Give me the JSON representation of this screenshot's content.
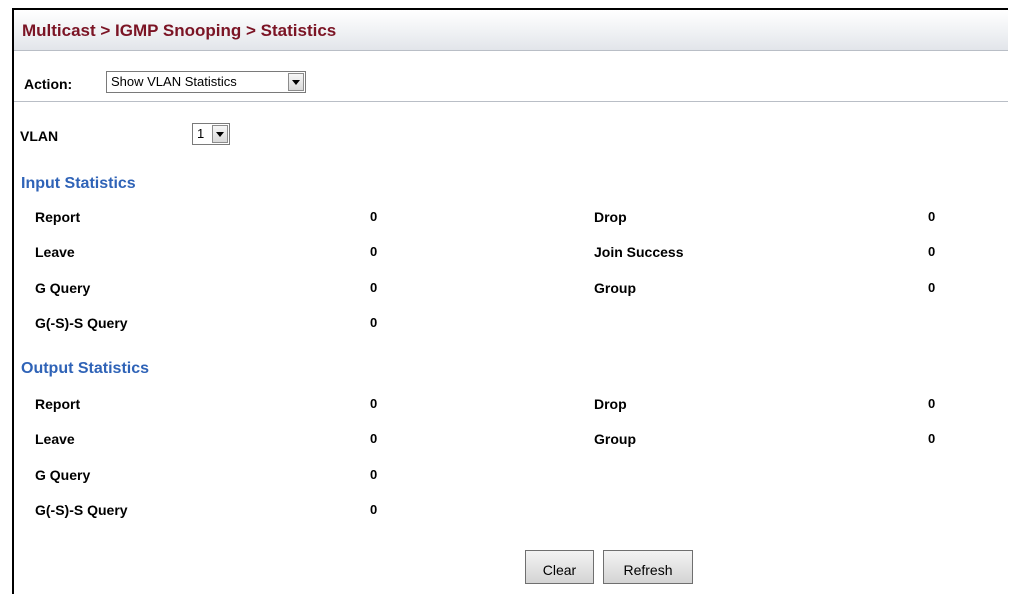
{
  "header": {
    "title": "Multicast > IGMP Snooping > Statistics"
  },
  "action": {
    "label": "Action:",
    "selected": "Show VLAN Statistics"
  },
  "vlan": {
    "label": "VLAN",
    "selected": "1"
  },
  "input_statistics": {
    "heading": "Input Statistics",
    "left": [
      {
        "label": "Report",
        "value": "0"
      },
      {
        "label": "Leave",
        "value": "0"
      },
      {
        "label": "G Query",
        "value": "0"
      },
      {
        "label": "G(-S)-S Query",
        "value": "0"
      }
    ],
    "right": [
      {
        "label": "Drop",
        "value": "0"
      },
      {
        "label": "Join Success",
        "value": "0"
      },
      {
        "label": "Group",
        "value": "0"
      }
    ]
  },
  "output_statistics": {
    "heading": "Output Statistics",
    "left": [
      {
        "label": "Report",
        "value": "0"
      },
      {
        "label": "Leave",
        "value": "0"
      },
      {
        "label": "G Query",
        "value": "0"
      },
      {
        "label": "G(-S)-S Query",
        "value": "0"
      }
    ],
    "right": [
      {
        "label": "Drop",
        "value": "0"
      },
      {
        "label": "Group",
        "value": "0"
      }
    ]
  },
  "buttons": {
    "clear": "Clear",
    "refresh": "Refresh"
  },
  "colors": {
    "title": "#7b1425",
    "section_heading": "#2f63b7"
  }
}
